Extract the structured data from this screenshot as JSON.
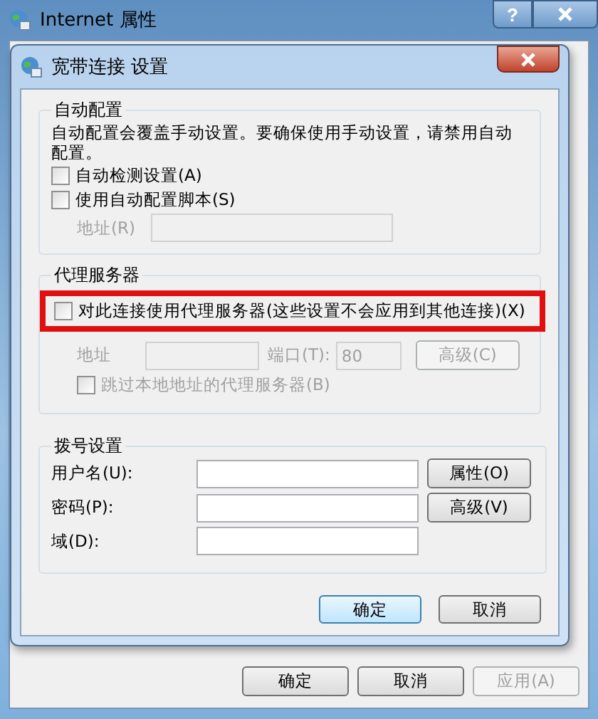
{
  "window": {
    "title": "Internet 属性",
    "help": "?"
  },
  "dialog": {
    "title": "宽带连接 设置"
  },
  "auto_config": {
    "heading": "自动配置",
    "note": "自动配置会覆盖手动设置。要确保使用手动设置，请禁用自动配置。",
    "options": [
      {
        "label": "自动检测设置(A)",
        "checked": false
      },
      {
        "label": "使用自动配置脚本(S)",
        "checked": false
      }
    ],
    "address": {
      "label": "地址(R)",
      "disabled": true
    }
  },
  "proxy": {
    "heading": "代理服务器",
    "disabled": true,
    "use_proxy": {
      "label": "对此连接使用代理服务器(这些设置不会应用到其他连接)(X)",
      "checked": false
    },
    "address_label": "地址",
    "port_label": "端口(T):",
    "port": "80",
    "advanced": "高级(C)",
    "bypass": {
      "label": "跳过本地地址的代理服务器(B)",
      "checked": false
    }
  },
  "dial": {
    "heading": "拨号设置",
    "fields": [
      {
        "label": "用户名(U):",
        "button": "属性(O)"
      },
      {
        "label": "密码(P):",
        "button": "高级(V)"
      },
      {
        "label": "域(D):"
      }
    ]
  },
  "dialog_buttons": [
    {
      "label": "确定",
      "default": true
    },
    {
      "label": "取消",
      "default": false
    }
  ],
  "window_buttons": [
    {
      "label": "确定",
      "disabled": false
    },
    {
      "label": "取消",
      "disabled": false
    },
    {
      "label": "应用(A)",
      "disabled": true
    }
  ]
}
